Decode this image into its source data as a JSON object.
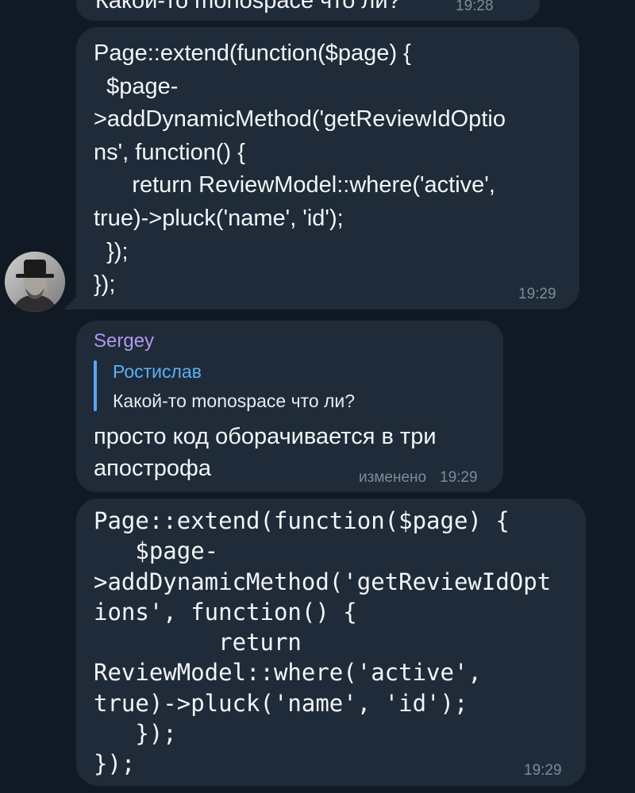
{
  "messages": {
    "prev": {
      "text": "Какой-то monospace что ли?",
      "time": "19:28"
    },
    "code_proportional": {
      "code": "Page::extend(function($page) {\n  $page-\n>addDynamicMethod('getReviewIdOptio\nns', function() {\n      return ReviewModel::where('active',\ntrue)->pluck('name', 'id');\n  });\n});",
      "time": "19:29"
    },
    "reply": {
      "sender": "Sergey",
      "quote_author": "Ростислав",
      "quote_text": "Какой-то monospace что ли?",
      "text": "просто код оборачивается в три апострофа",
      "edited_label": "изменено",
      "time": "19:29"
    },
    "code_monospace": {
      "code": "Page::extend(function($page) {\n   $page-\n>addDynamicMethod('getReviewIdOpt\nions', function() {\n         return\nReviewModel::where('active',\ntrue)->pluck('name', 'id');\n   });\n});",
      "time": "19:29"
    }
  },
  "avatar": {
    "icon": "user-avatar-photo"
  },
  "colors": {
    "background": "#111a24",
    "bubble": "#1f2b38",
    "sender_name": "#b197f0",
    "quote_accent": "#5aa6f0",
    "timestamp": "#7d8b99"
  }
}
